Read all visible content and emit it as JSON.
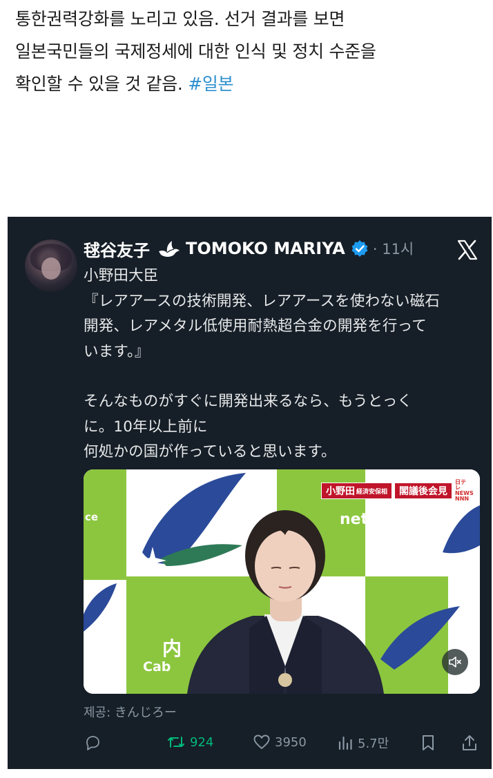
{
  "post": {
    "line1": "통한권력강화를 노리고 있음.  선거 결과를 보면",
    "line2": "일본국민들의 국제정세에 대한 인식 및 정치 수준을",
    "line3_text": "확인할 수 있을 것 같음. ",
    "hashtag": "#일본"
  },
  "tweet": {
    "author_jp": "毬谷友子",
    "author_en": "TOMOKO MARIYA",
    "time": "· 11시",
    "body": [
      "小野田大臣",
      "『レアアースの技術開発、レアアースを使わない磁石",
      "開発、レアメタル低使用耐熱超合金の開発を行って",
      "います。』",
      "",
      "そんなものがすぐに開発出来るなら、もうとっく",
      "に。10年以上前に",
      "何処かの国が作っていると思います。"
    ],
    "video": {
      "caption_name": "小野田",
      "caption_role": "経済安保相",
      "caption_title": "閣議後会見",
      "news_logo": "日テレNEWS NNN",
      "bg_text_office": "net Office",
      "bg_text_ce": "ce",
      "bg_text_cab": "Cab",
      "bg_text_naikaku": "内"
    },
    "provided_by": "제공: きんじろー",
    "stats": {
      "retweets": "924",
      "likes": "3950",
      "views": "5.7만"
    },
    "colors": {
      "background": "#161e27",
      "retweet": "#00ba7c",
      "muted": "#8b98a5",
      "hashtag": "#2d8fcf"
    }
  }
}
